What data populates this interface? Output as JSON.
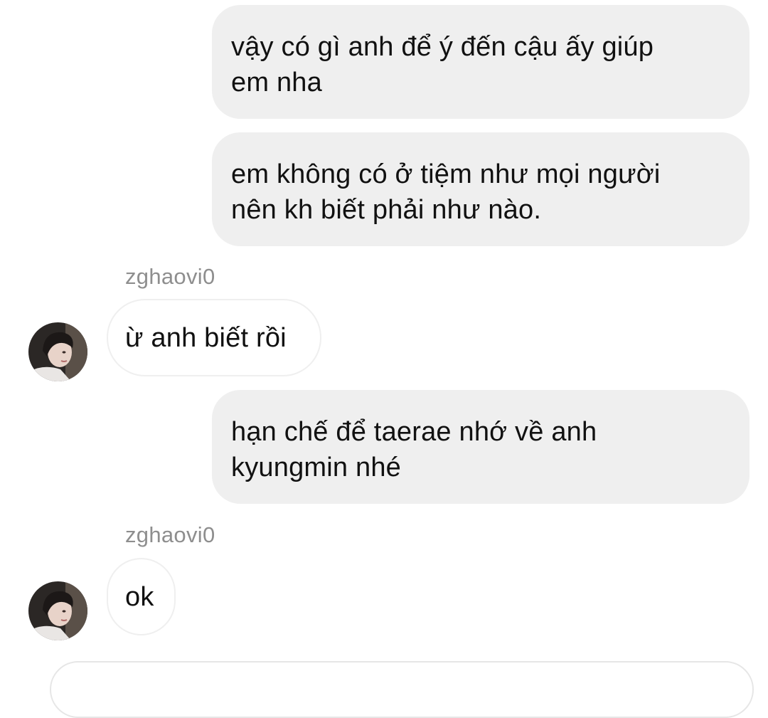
{
  "messages": [
    {
      "direction": "sent",
      "lines": [
        "vậy có gì anh để ý đến cậu ấy giúp",
        "em nha"
      ]
    },
    {
      "direction": "sent",
      "lines": [
        "em không có ở tiệm như mọi người",
        "nên kh biết phải như nào."
      ]
    },
    {
      "direction": "received",
      "sender": "zghaovi0",
      "lines": [
        "ừ anh biết rồi"
      ]
    },
    {
      "direction": "sent",
      "lines": [
        "hạn chế để taerae nhớ về anh",
        "kyungmin nhé"
      ]
    },
    {
      "direction": "received",
      "sender": "zghaovi0",
      "lines": [
        "ok"
      ]
    }
  ],
  "colors": {
    "sent_bubble": "#efefef",
    "received_border": "#efefef",
    "sender_name": "#8e8e8e",
    "text": "#111111"
  },
  "icons": {
    "avatar": "user-photo-avatar"
  }
}
